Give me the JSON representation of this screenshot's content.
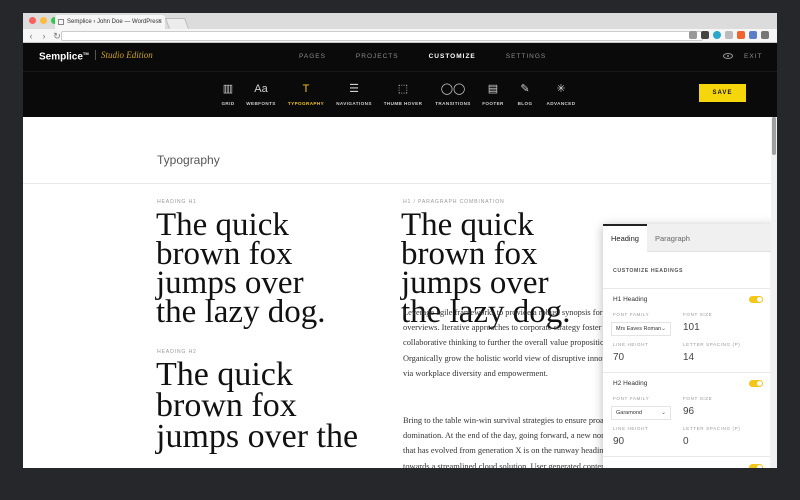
{
  "browser": {
    "tab_title": "Semplice › John Doe — WordPress",
    "tab_close": "×",
    "nav_back": "‹",
    "nav_forward": "›",
    "nav_reload": "↻"
  },
  "topbar": {
    "brand": "Semplice",
    "brand_mark": "TM",
    "edition": "Studio Edition",
    "nav": [
      "PAGES",
      "PROJECTS",
      "CUSTOMIZE",
      "SETTINGS"
    ],
    "active_nav": "CUSTOMIZE",
    "exit_label": "EXIT"
  },
  "toolbar": {
    "tools": [
      {
        "label": "GRID",
        "icon": "grid-icon",
        "glyph": "▥"
      },
      {
        "label": "WEBFONTS",
        "icon": "webfonts-icon",
        "glyph": "Aa"
      },
      {
        "label": "TYPOGRAPHY",
        "icon": "typography-icon",
        "glyph": "T"
      },
      {
        "label": "NAVIGATIONS",
        "icon": "navigations-icon",
        "glyph": "☰"
      },
      {
        "label": "THUMB HOVER",
        "icon": "thumb-hover-icon",
        "glyph": "⬚"
      },
      {
        "label": "TRANSITIONS",
        "icon": "transitions-icon",
        "glyph": "◯◯"
      },
      {
        "label": "FOOTER",
        "icon": "footer-icon",
        "glyph": "▤"
      },
      {
        "label": "BLOG",
        "icon": "blog-icon",
        "glyph": "✎"
      },
      {
        "label": "ADVANCED",
        "icon": "advanced-icon",
        "glyph": "✳"
      }
    ],
    "active_tool": "TYPOGRAPHY",
    "save_label": "SAVE",
    "accent_color": "#f5c518"
  },
  "content": {
    "section_title": "Typography",
    "heading_h1_label": "HEADING H1",
    "heading_h1_sample": "The quick\nbrown fox\njumps over\nthe lazy dog.",
    "heading_h2_label": "HEADING H2",
    "heading_h2_sample": "The quick\nbrown fox\njumps over the",
    "combo_label": "H1 / PARAGRAPH COMBINATION",
    "combo_h1_sample": "The quick\nbrown fox\njumps over\nthe lazy dog.",
    "paragraph_1": "Leverage agile frameworks to provide a robust synopsis for high level\noverviews. Iterative approaches to corporate strategy foster\ncollaborative thinking to further the overall value proposition.\nOrganically grow the holistic world view of disruptive innovation\nvia workplace diversity and empowerment.",
    "paragraph_2": "Bring to the table win-win survival strategies to ensure proactive\ndomination. At the end of the day, going forward, a new normal\nthat has evolved from generation X is on the runway heading\ntowards a streamlined cloud solution. User generated content in"
  },
  "panel": {
    "tabs": [
      "Heading",
      "Paragraph"
    ],
    "active_tab": "Heading",
    "section_heading": "CUSTOMIZE HEADINGS",
    "headings": [
      {
        "name": "H1 Heading",
        "enabled": true,
        "font_family_label": "FONT FAMILY",
        "font_family": "Mrs Eaves Roman",
        "font_size_label": "FONT SIZE",
        "font_size": "101",
        "line_height_label": "LINE HEIGHT",
        "line_height": "70",
        "letter_spacing_label": "LETTER SPACING (P)",
        "letter_spacing": "14"
      },
      {
        "name": "H2 Heading",
        "enabled": true,
        "font_family_label": "FONT FAMILY",
        "font_family": "Garamond",
        "font_size_label": "FONT SIZE",
        "font_size": "96",
        "line_height_label": "LINE HEIGHT",
        "line_height": "90",
        "letter_spacing_label": "LETTER SPACING (P)",
        "letter_spacing": "0"
      }
    ]
  }
}
